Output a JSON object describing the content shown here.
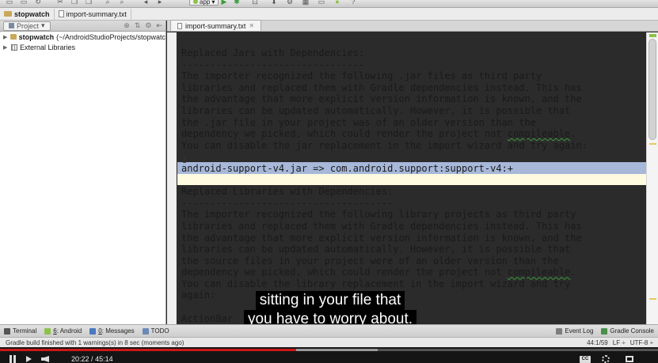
{
  "toolbar": {
    "run_config": "app"
  },
  "breadcrumb": [
    {
      "label": "stopwatch",
      "kind": "folder"
    },
    {
      "label": "import-summary.txt",
      "kind": "file"
    }
  ],
  "project_panel": {
    "view_label": "Project",
    "tree": [
      {
        "label": "stopwatch",
        "path": "(~/AndroidStudioProjects/stopwatc",
        "kind": "folder"
      },
      {
        "label": "External Libraries",
        "path": "",
        "kind": "library"
      }
    ]
  },
  "editor": {
    "tab_label": "import-summary.txt",
    "lines": [
      "Replaced Jars with Dependencies:",
      "--------------------------------",
      "The importer recognized the following .jar files as third party",
      "libraries and replaced them with Gradle dependencies instead. This has",
      "the advantage that more explicit version information is known, and the",
      "libraries can be updated automatically. However, it is possible that",
      "the .jar file in your project was of an older version than the",
      "dependency we picked, which could render the project not compileable.",
      "You can disable the jar replacement in the import wizard and try again:",
      "",
      "android-support-v4.jar => com.android.support:support-v4:+",
      "",
      "Replaced Libraries with Dependencies:",
      "-------------------------------------",
      "The importer recognized the following library projects as third party",
      "libraries and replaced them with Gradle dependencies instead. This has",
      "the advantage that more explicit version information is known, and the",
      "libraries can be updated automatically. However, it is possible that",
      "the source files in your project were of an older version than the",
      "dependency we picked, which could render the project not compileable.",
      "You can disable the library replacement in the import wizard and try",
      "again:",
      "",
      "ActionBar"
    ],
    "selected_line": 10
  },
  "subtitle": {
    "line1": "sitting in your file that",
    "line2": "you have to worry about."
  },
  "tool_windows": {
    "left": [
      {
        "label": "Terminal",
        "key": "",
        "color": "#555555"
      },
      {
        "label": "Android",
        "key": "6",
        "color": "#8bc34a"
      },
      {
        "label": "Messages",
        "key": "0",
        "color": "#4a78c2"
      },
      {
        "label": "TODO",
        "key": "",
        "color": "#6a8ab8"
      }
    ],
    "right": [
      {
        "label": "Event Log",
        "color": "#7d7d7d"
      },
      {
        "label": "Gradle Console",
        "color": "#4a8f4a"
      }
    ]
  },
  "status": {
    "message": "Gradle build finished with 1 warnings(s) in 8 sec (moments ago)",
    "position": "44:1/59",
    "line_sep": "LF ÷",
    "encoding": "UTF-8 ÷"
  },
  "player": {
    "current_time": "20:22",
    "total_time": "45:14",
    "progress": 0.45,
    "cc_label": "CC"
  },
  "colors": {
    "selection": "#a7b8d9",
    "caret_line": "#fffbe0",
    "progress": "#cc1818"
  }
}
